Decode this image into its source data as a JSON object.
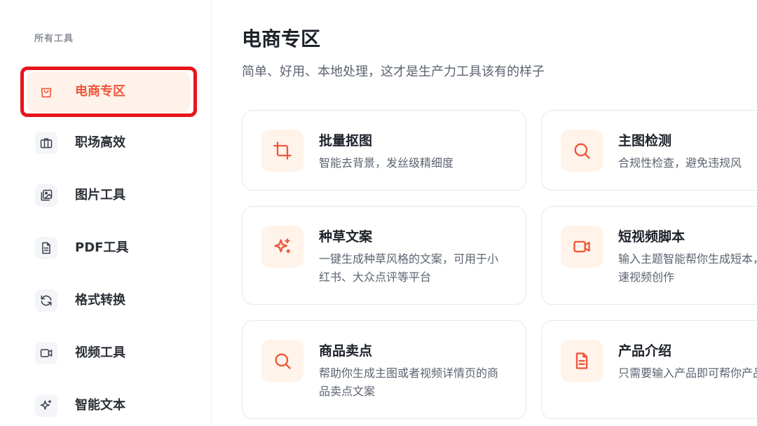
{
  "sidebar": {
    "heading": "所有工具",
    "items": [
      {
        "label": "电商专区",
        "icon": "shopping-bag-icon",
        "active": true
      },
      {
        "label": "职场高效",
        "icon": "briefcase-icon",
        "active": false
      },
      {
        "label": "图片工具",
        "icon": "images-icon",
        "active": false
      },
      {
        "label": "PDF工具",
        "icon": "document-icon",
        "active": false
      },
      {
        "label": "格式转换",
        "icon": "refresh-icon",
        "active": false
      },
      {
        "label": "视频工具",
        "icon": "video-icon",
        "active": false
      },
      {
        "label": "智能文本",
        "icon": "sparkles-icon",
        "active": false
      }
    ]
  },
  "main": {
    "title": "电商专区",
    "subtitle": "简单、好用、本地处理，这才是生产力工具该有的样子",
    "cards": [
      {
        "title": "批量抠图",
        "desc": "智能去背景，发丝级精细度",
        "icon": "crop-icon"
      },
      {
        "title": "主图检测",
        "desc": "合规性检查，避免违规风",
        "icon": "search-icon"
      },
      {
        "title": "种草文案",
        "desc": "一键生成种草风格的文案，可用于小红书、大众点评等平台",
        "icon": "sparkles-icon"
      },
      {
        "title": "短视频脚本",
        "desc": "输入主题智能帮你生成短本，助你快速视频创作",
        "icon": "video-icon"
      },
      {
        "title": "商品卖点",
        "desc": "帮助你生成主图或者视频详情页的商品卖点文案",
        "icon": "search-icon"
      },
      {
        "title": "产品介绍",
        "desc": "只需要输入产品即可帮你产品介绍",
        "icon": "document-icon"
      }
    ]
  },
  "colors": {
    "accent": "#f0563b",
    "active_bg": "#fff2ea",
    "card_icon_bg": "#fff3ea",
    "highlight_border": "#e8141b"
  }
}
